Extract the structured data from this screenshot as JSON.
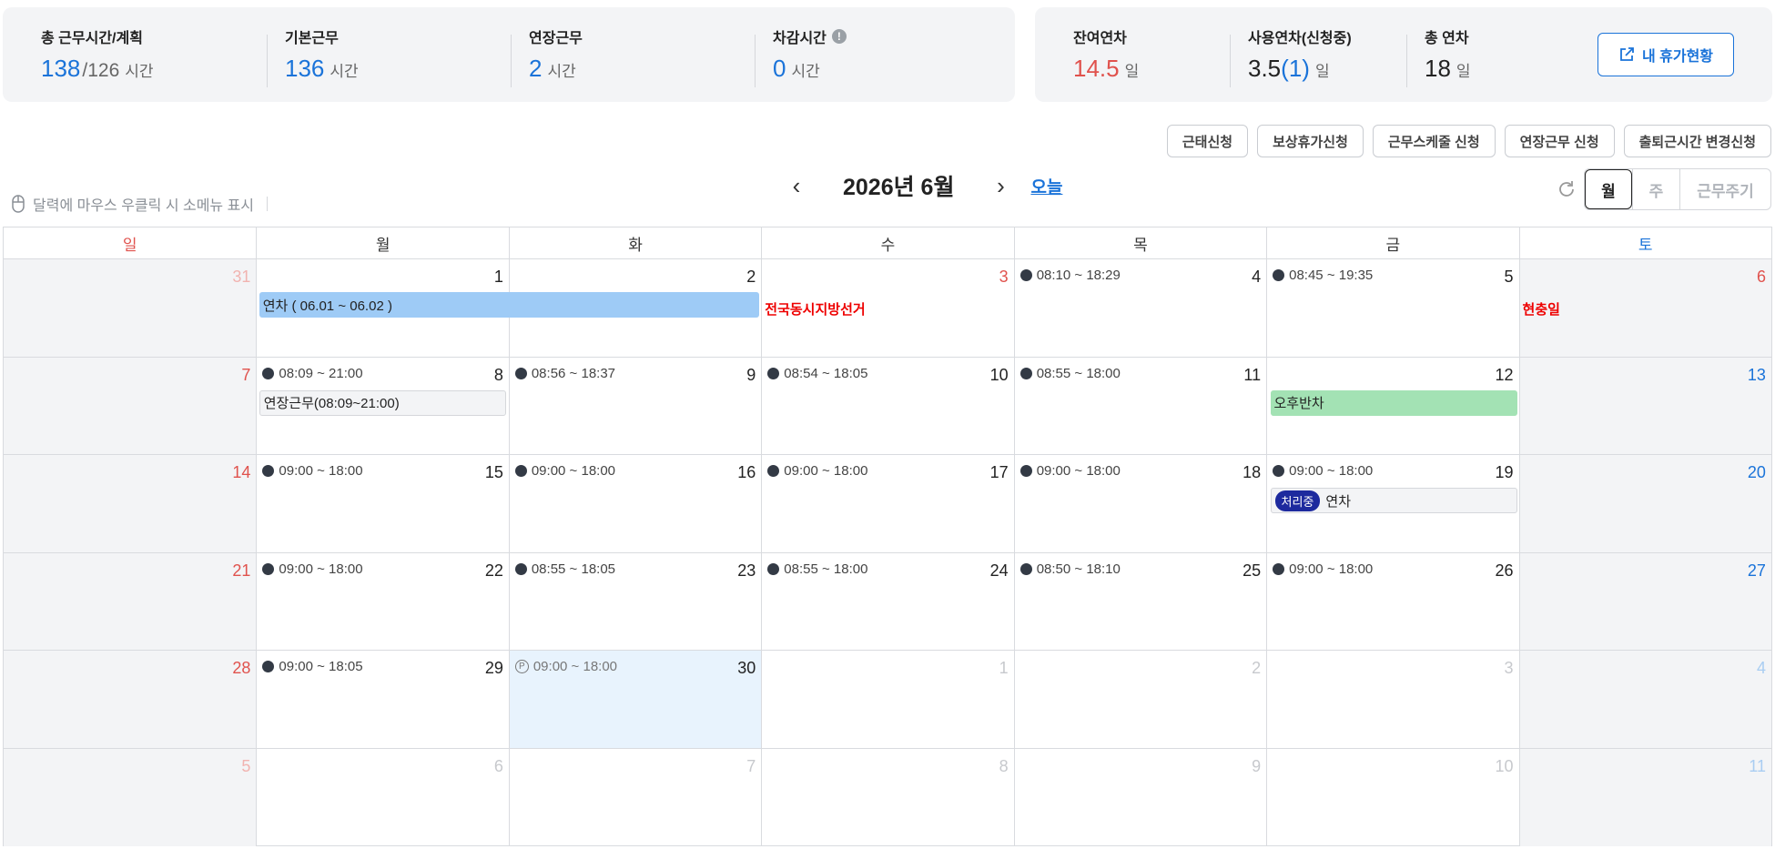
{
  "summary": {
    "total": {
      "label": "총 근무시간/계획",
      "value": "138",
      "plan": "/126",
      "unit": "시간"
    },
    "basic": {
      "label": "기본근무",
      "value": "136",
      "unit": "시간"
    },
    "overtime": {
      "label": "연장근무",
      "value": "2",
      "unit": "시간"
    },
    "deduction": {
      "label": "차감시간",
      "value": "0",
      "unit": "시간",
      "info_icon": "!"
    }
  },
  "leave": {
    "remaining": {
      "label": "잔여연차",
      "value": "14.5",
      "unit": "일"
    },
    "used": {
      "label": "사용연차(신청중)",
      "value": "3.5",
      "pending": "(1)",
      "unit": "일"
    },
    "total": {
      "label": "총 연차",
      "value": "18",
      "unit": "일"
    },
    "status_button": "내 휴가현황"
  },
  "requests": [
    "근태신청",
    "보상휴가신청",
    "근무스케줄 신청",
    "연장근무 신청",
    "출퇴근시간 변경신청"
  ],
  "hint": "달력에 마우스 우클릭 시 소메뉴 표시",
  "nav": {
    "prev": "‹",
    "next": "›",
    "title": "2026년 6월",
    "today": "오늘"
  },
  "views": [
    "월",
    "주",
    "근무주기"
  ],
  "weekdays": [
    "일",
    "월",
    "화",
    "수",
    "목",
    "금",
    "토"
  ],
  "weeks": [
    [
      {
        "n": "31",
        "other": true
      },
      {
        "n": "1"
      },
      {
        "n": "2"
      },
      {
        "n": "3",
        "red": true,
        "holiday": "전국동시지방선거"
      },
      {
        "n": "4",
        "time": "08:10 ~ 18:29"
      },
      {
        "n": "5",
        "time": "08:45 ~ 19:35"
      },
      {
        "n": "6",
        "red": true,
        "holiday": "현충일"
      }
    ],
    [
      {
        "n": "7"
      },
      {
        "n": "8",
        "time": "08:09 ~ 21:00"
      },
      {
        "n": "9",
        "time": "08:56 ~ 18:37"
      },
      {
        "n": "10",
        "time": "08:54 ~ 18:05"
      },
      {
        "n": "11",
        "time": "08:55 ~ 18:00"
      },
      {
        "n": "12"
      },
      {
        "n": "13"
      }
    ],
    [
      {
        "n": "14"
      },
      {
        "n": "15",
        "time": "09:00 ~ 18:00"
      },
      {
        "n": "16",
        "time": "09:00 ~ 18:00"
      },
      {
        "n": "17",
        "time": "09:00 ~ 18:00"
      },
      {
        "n": "18",
        "time": "09:00 ~ 18:00"
      },
      {
        "n": "19",
        "time": "09:00 ~ 18:00"
      },
      {
        "n": "20"
      }
    ],
    [
      {
        "n": "21"
      },
      {
        "n": "22",
        "time": "09:00 ~ 18:00"
      },
      {
        "n": "23",
        "time": "08:55 ~ 18:05"
      },
      {
        "n": "24",
        "time": "08:55 ~ 18:00"
      },
      {
        "n": "25",
        "time": "08:50 ~ 18:10"
      },
      {
        "n": "26",
        "time": "09:00 ~ 18:00"
      },
      {
        "n": "27"
      }
    ],
    [
      {
        "n": "28"
      },
      {
        "n": "29",
        "time": "09:00 ~ 18:05"
      },
      {
        "n": "30",
        "time": "09:00 ~ 18:00",
        "planned": true,
        "today": true
      },
      {
        "n": "1",
        "other": true
      },
      {
        "n": "2",
        "other": true
      },
      {
        "n": "3",
        "other": true
      },
      {
        "n": "4",
        "other": true
      }
    ],
    [
      {
        "n": "5",
        "other": true
      },
      {
        "n": "6",
        "other": true
      },
      {
        "n": "7",
        "other": true
      },
      {
        "n": "8",
        "other": true
      },
      {
        "n": "9",
        "other": true
      },
      {
        "n": "10",
        "other": true
      },
      {
        "n": "11",
        "other": true
      }
    ]
  ],
  "events": [
    {
      "week": 0,
      "start": 1,
      "span": 2,
      "label": "연차 ( 06.01 ~ 06.02 )",
      "style": "blue"
    },
    {
      "week": 1,
      "start": 1,
      "span": 1,
      "label": "연장근무(08:09~21:00)",
      "style": "gray"
    },
    {
      "week": 1,
      "start": 5,
      "span": 1,
      "label": "오후반차",
      "style": "green"
    },
    {
      "week": 2,
      "start": 5,
      "span": 1,
      "label": "연차",
      "badge": "처리중",
      "style": "gray"
    }
  ],
  "icons": {
    "info": "info-icon",
    "external": "external-link-icon",
    "mouse": "mouse-icon",
    "refresh": "refresh-icon",
    "dot": "dot-icon",
    "planned": "planned-icon"
  },
  "colors": {
    "accent": "#1a73d9",
    "sunday": "#e0524d",
    "saturday": "#1a73d9",
    "holiday": "#e00000",
    "pending_badge": "#1d2a9e"
  }
}
